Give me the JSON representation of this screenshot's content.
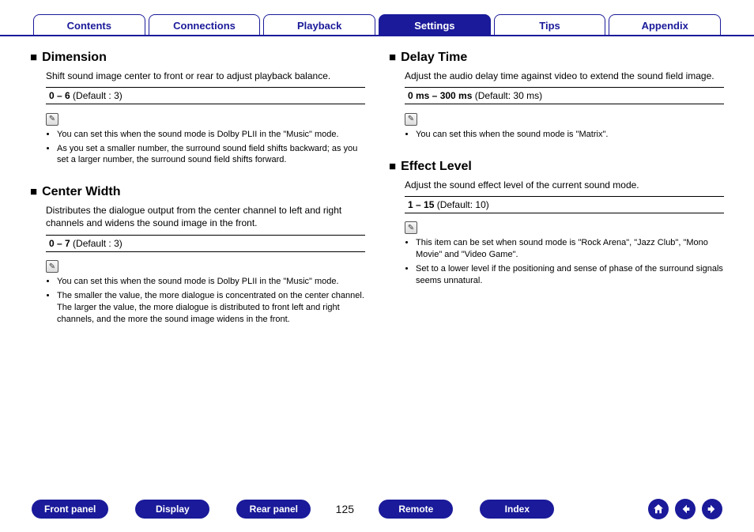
{
  "tabs": [
    "Contents",
    "Connections",
    "Playback",
    "Settings",
    "Tips",
    "Appendix"
  ],
  "active_tab": 3,
  "left": [
    {
      "title": "Dimension",
      "desc": "Shift sound image center to front or rear to adjust playback balance.",
      "range": "0 – 6",
      "default": "(Default : 3)",
      "notes": [
        "You can set this when the sound mode is Dolby PLII in the \"Music\" mode.",
        "As you set a smaller number, the surround sound field shifts backward; as you set a larger number, the surround sound field shifts forward."
      ]
    },
    {
      "title": "Center Width",
      "desc": "Distributes the dialogue output from the center channel to left and right channels and widens the sound image in the front.",
      "range": "0 – 7",
      "default": "(Default : 3)",
      "notes": [
        "You can set this when the sound mode is Dolby PLII in the \"Music\" mode.",
        "The smaller the value, the more dialogue is concentrated on the center channel. The larger the value, the more dialogue is distributed to front left and right channels, and the more the sound image widens in the front."
      ]
    }
  ],
  "right": [
    {
      "title": "Delay Time",
      "desc": "Adjust the audio delay time against video to extend the sound field image.",
      "range": "0 ms – 300 ms",
      "default": "(Default: 30 ms)",
      "notes": [
        "You can set this when the sound mode is \"Matrix\"."
      ]
    },
    {
      "title": "Effect Level",
      "desc": "Adjust the sound effect level of the current sound mode.",
      "range": "1 – 15",
      "default": "(Default: 10)",
      "notes": [
        "This item can be set when sound mode is \"Rock Arena\", \"Jazz Club\", \"Mono Movie\" and \"Video Game\".",
        "Set to a lower level if the positioning and sense of phase of the surround signals seems unnatural."
      ]
    }
  ],
  "bottom_links": [
    "Front panel",
    "Display",
    "Rear panel"
  ],
  "bottom_links_right": [
    "Remote",
    "Index"
  ],
  "page_number": "125",
  "nav_icons": [
    "home-icon",
    "back-icon",
    "forward-icon"
  ]
}
